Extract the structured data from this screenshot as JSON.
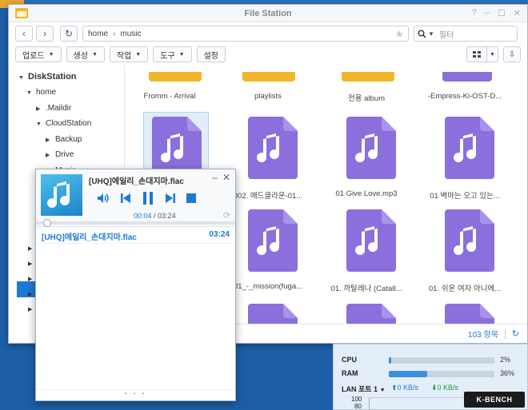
{
  "window": {
    "title": "File Station",
    "controls": [
      "?",
      "–",
      "☐",
      "✕"
    ]
  },
  "address": {
    "path": [
      "home",
      "music"
    ],
    "search_placeholder": "필터"
  },
  "toolbar": {
    "upload": "업로드",
    "create": "생성",
    "action": "작업",
    "tools": "도구",
    "settings": "설정"
  },
  "sidebar": {
    "root": "DiskStation",
    "home": "home",
    "maildir": ".Maildir",
    "cloudstation": "CloudStation",
    "backup": "Backup",
    "drive": "Drive",
    "music": "Music"
  },
  "grid": {
    "row1": [
      "Fromm - Arrival",
      "playlists",
      "전용 album",
      "-Empress-Ki-OST-D..."
    ],
    "row2": [
      "",
      "002. 매드클라운-01...",
      "01 Give Love.mp3",
      "01 벽마는 오고 있는..."
    ],
    "row3": [
      "",
      "01_-_mission(fuga...",
      "01. 까탈레나 (Catall...",
      "01. 쉬운 여자 아니에..."
    ]
  },
  "status": {
    "count": "103 항목"
  },
  "player": {
    "title": "[UHQ]에일리_손대지마.flac",
    "time_current": "00:04",
    "time_sep": " / ",
    "time_total": "03:24",
    "track_name": "[UHQ]에일리_손대지마.flac",
    "track_duration": "03:24",
    "progress": 0.02
  },
  "resource": {
    "cpu_label": "CPU",
    "cpu_value": "2%",
    "cpu_pct": 2,
    "ram_label": "RAM",
    "ram_value": "36%",
    "ram_pct": 36,
    "lan_label": "LAN 포트 1",
    "lan_up": "0 KB/s",
    "lan_down": "0 KB/s",
    "graph_top": "100",
    "graph_mid": "80"
  },
  "watermark": "K-BENCH",
  "colors": {
    "accent": "#1d79d8",
    "music_file": "#8b6fdc",
    "folder": "#f1b62b"
  }
}
